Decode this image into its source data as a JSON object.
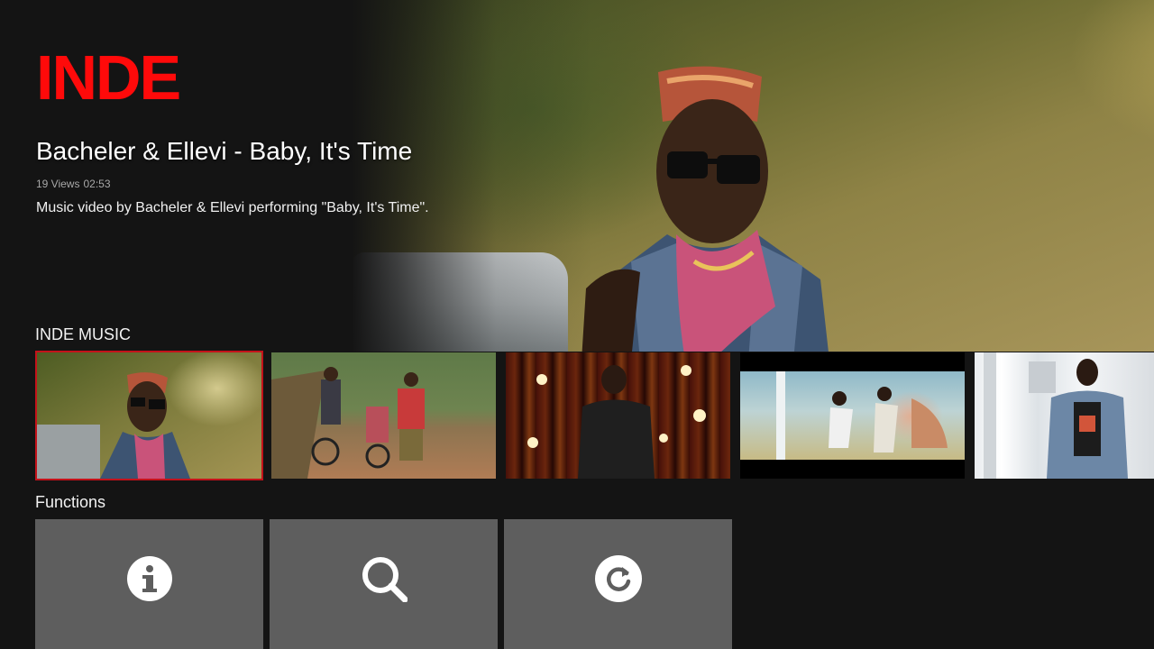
{
  "app": {
    "logo_text": "INDE",
    "brand_color": "#ff0a0a"
  },
  "hero": {
    "title": "Bacheler & Ellevi - Baby, It's Time",
    "views": "19 Views",
    "duration": "02:53",
    "description": "Music video by Bacheler & Ellevi performing \"Baby, It's Time\"."
  },
  "rows": {
    "music": {
      "header": "INDE MUSIC",
      "cards": [
        {
          "icon": "video-thumbnail",
          "selected": true
        },
        {
          "icon": "video-thumbnail",
          "selected": false
        },
        {
          "icon": "video-thumbnail",
          "selected": false
        },
        {
          "icon": "video-thumbnail",
          "selected": false
        },
        {
          "icon": "video-thumbnail",
          "selected": false
        }
      ]
    },
    "functions": {
      "header": "Functions",
      "tiles": [
        {
          "icon": "info-icon"
        },
        {
          "icon": "search-icon"
        },
        {
          "icon": "refresh-icon"
        }
      ]
    }
  },
  "colors": {
    "background": "#141414",
    "selection_border": "#c4121a",
    "tile": "#5e5e5e"
  }
}
